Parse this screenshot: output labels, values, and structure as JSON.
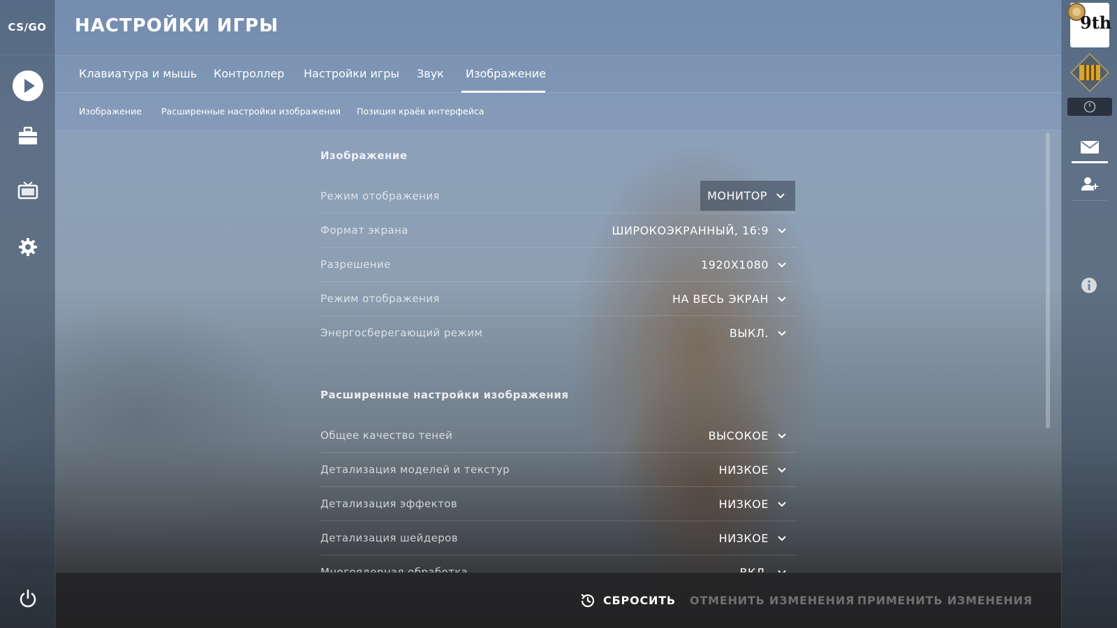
{
  "app": {
    "logo_text": "CS∕GO",
    "title": "НАСТРОЙКИ ИГРЫ"
  },
  "tabs": [
    {
      "label": "Клавиатура и мышь",
      "active": false
    },
    {
      "label": "Контроллер",
      "active": false
    },
    {
      "label": "Настройки игры",
      "active": false
    },
    {
      "label": "Звук",
      "active": false
    },
    {
      "label": "Изображение",
      "active": true
    }
  ],
  "subtabs": [
    {
      "label": "Изображение"
    },
    {
      "label": "Расширенные настройки изображения"
    },
    {
      "label": "Позиция краёв интерфейса"
    }
  ],
  "sections": {
    "display": {
      "title": "Изображение",
      "rows": [
        {
          "label": "Режим отображения",
          "value": "МОНИТОР"
        },
        {
          "label": "Формат экрана",
          "value": "ШИРОКОЭКРАННЫЙ, 16:9"
        },
        {
          "label": "Разрешение",
          "value": "1920X1080"
        },
        {
          "label": "Режим отображения",
          "value": "НА ВЕСЬ ЭКРАН"
        },
        {
          "label": "Энергосберегающий режим",
          "value": "ВЫКЛ."
        }
      ]
    },
    "advanced": {
      "title": "Расширенные настройки изображения",
      "rows": [
        {
          "label": "Общее качество теней",
          "value": "ВЫСОКОЕ"
        },
        {
          "label": "Детализация моделей и текстур",
          "value": "НИЗКОЕ"
        },
        {
          "label": "Детализация эффектов",
          "value": "НИЗКОЕ"
        },
        {
          "label": "Детализация шейдеров",
          "value": "НИЗКОЕ"
        },
        {
          "label": "Многоядерная обработка",
          "value": "ВКЛ."
        }
      ]
    }
  },
  "footer": {
    "reset_label": "СБРОСИТЬ",
    "cancel_label": "ОТМЕНИТЬ ИЗМЕНЕНИЯ",
    "apply_label": "ПРИМЕНИТЬ ИЗМЕНЕНИЯ"
  },
  "right_rail": {
    "rank_badge": "9th"
  },
  "icons": {
    "play": "play-icon",
    "inventory": "briefcase-icon",
    "watch": "tv-icon",
    "settings": "gear-icon",
    "power": "power-icon",
    "reset": "history-icon",
    "mail": "mail-icon",
    "add_friend": "add-friend-icon",
    "info": "info-icon",
    "chevron": "chevron-down-icon"
  },
  "colors": {
    "text": "#ffffff",
    "accent_disabled": "rgba(255,255,255,0.35)"
  }
}
